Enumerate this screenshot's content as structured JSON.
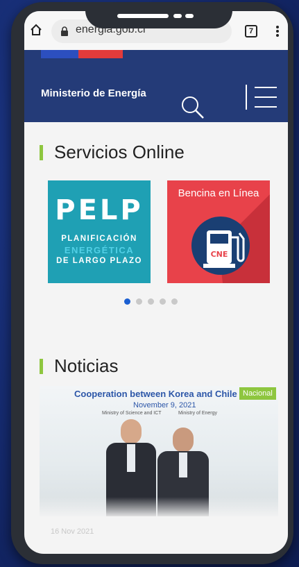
{
  "browser": {
    "url": "energia.gob.cl",
    "tab_count": "7"
  },
  "site": {
    "title": "Ministerio de Energía"
  },
  "services": {
    "heading": "Servicios Online",
    "cards": [
      {
        "name": "pelp",
        "logo": "PELP",
        "lines": [
          "PLANIFICACIÓN",
          "ENERGÉTICA",
          "DE LARGO PLAZO"
        ]
      },
      {
        "name": "bencina",
        "label": "Bencina en Línea",
        "icon_text": "CNE"
      }
    ],
    "carousel": {
      "total": 5,
      "active": 1
    }
  },
  "news": {
    "heading": "Noticias",
    "items": [
      {
        "image_headline": "Cooperation between Korea and Chile",
        "image_date": "November 9, 2021",
        "image_sub_left": "Ministry of Science and ICT",
        "image_sub_right": "Ministry of Energy",
        "badge": "Nacional",
        "date": "16 Nov 2021"
      }
    ]
  },
  "colors": {
    "header": "#243b78",
    "accent": "#8ec63f",
    "pelp": "#1fa0b4",
    "bencina": "#e8424a",
    "carousel_active": "#1b5fd1"
  }
}
